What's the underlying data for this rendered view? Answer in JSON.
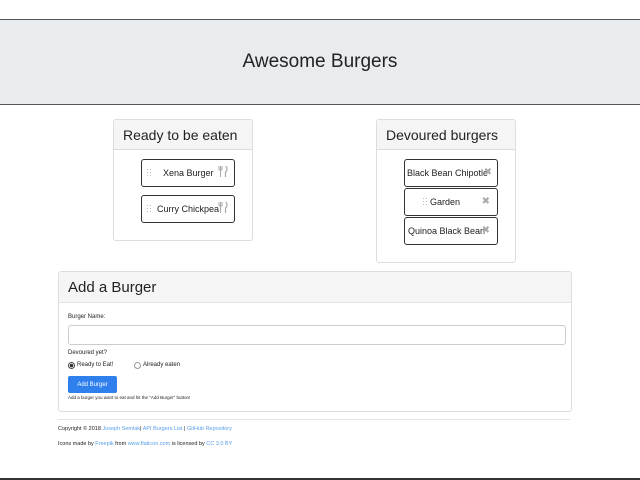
{
  "header": {
    "title": "Awesome Burgers"
  },
  "ready_panel": {
    "title": "Ready to be eaten",
    "items": [
      {
        "name": "Xena Burger",
        "icon": "fork-knife-icon"
      },
      {
        "name": "Curry Chickpea",
        "icon": "fork-knife-icon"
      }
    ]
  },
  "devoured_panel": {
    "title": "Devoured burgers",
    "items": [
      {
        "name": "Black Bean Chipotle",
        "icon": "x-icon"
      },
      {
        "name": "Garden",
        "icon": "x-icon"
      },
      {
        "name": "Quinoa Black Bean",
        "icon": "x-icon"
      }
    ]
  },
  "form": {
    "title": "Add a Burger",
    "name_label": "Burger Name:",
    "name_value": "",
    "devoured_label": "Devoured yet?",
    "options": [
      {
        "label": "Ready to Eat!",
        "checked": true
      },
      {
        "label": "Already eaten",
        "checked": false
      }
    ],
    "submit_label": "Add Burger",
    "help_text": "Add a burger you want to eat and hit the \"Add Burger\" button!"
  },
  "footer": {
    "line1": {
      "prefix": "Copyright © 2018 ",
      "author": "Joseph Semlak",
      "sep1": "| ",
      "api": "API Burgers List",
      "sep2": " | ",
      "repo": "GitHub Repository"
    },
    "line2": {
      "prefix": "Icons made by ",
      "freepik": "Freepik",
      "from": " from ",
      "site": "www.flaticon.com",
      "licensed": " is licensed by ",
      "license": "CC 3.0 BY"
    }
  },
  "colors": {
    "accent": "#2f80ed",
    "link": "#5aa0e8",
    "jumbotron": "#e9ecef"
  }
}
